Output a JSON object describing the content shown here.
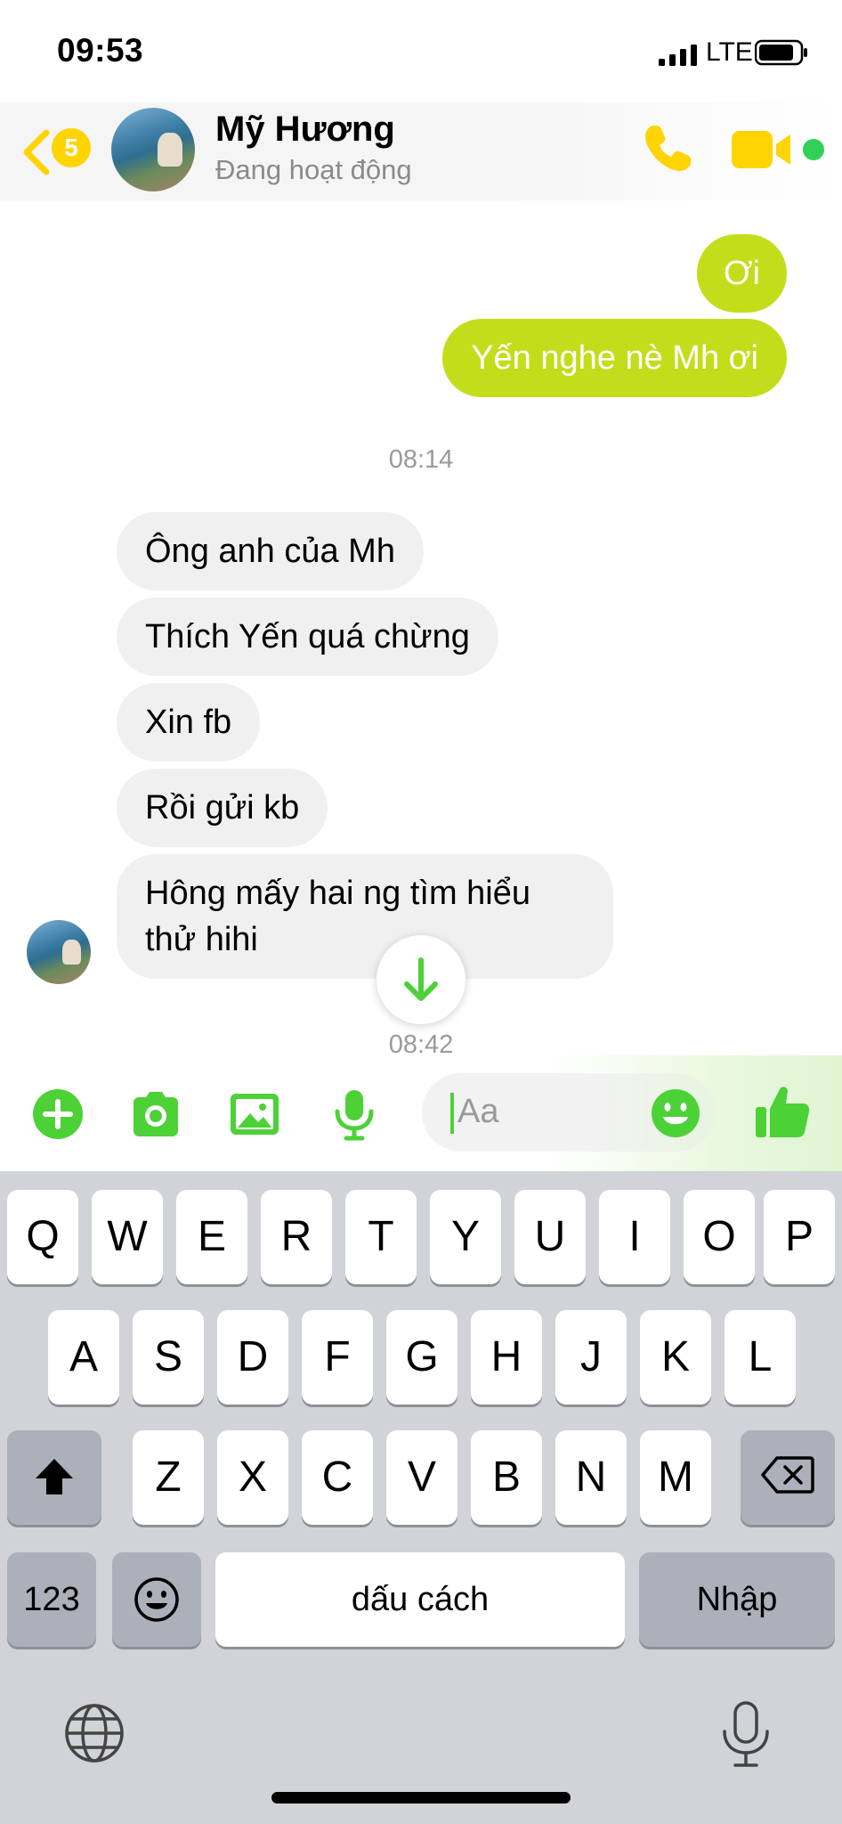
{
  "status_bar": {
    "time": "09:53",
    "network": "LTE"
  },
  "header": {
    "unread_count": "5",
    "contact_name": "Mỹ Hương",
    "contact_status": "Đang hoạt động"
  },
  "messages": [
    {
      "direction": "out",
      "text": "Ơi"
    },
    {
      "direction": "out",
      "text": "Yến nghe nè Mh ơi"
    },
    {
      "type": "timestamp",
      "text": "08:14"
    },
    {
      "direction": "in",
      "text": "Ông anh của Mh"
    },
    {
      "direction": "in",
      "text": "Thích Yến quá chừng"
    },
    {
      "direction": "in",
      "text": "Xin fb"
    },
    {
      "direction": "in",
      "text": "Rồi gửi kb"
    },
    {
      "direction": "in",
      "text_line1": "Hông mấy hai ng tìm hiểu",
      "text_line2": "thử hihi"
    },
    {
      "type": "timestamp",
      "text": "08:42"
    }
  ],
  "composer": {
    "placeholder": "Aa"
  },
  "keyboard": {
    "row1": [
      "Q",
      "W",
      "E",
      "R",
      "T",
      "Y",
      "U",
      "I",
      "O",
      "P"
    ],
    "row2": [
      "A",
      "S",
      "D",
      "F",
      "G",
      "H",
      "J",
      "K",
      "L"
    ],
    "row3": [
      "Z",
      "X",
      "C",
      "V",
      "B",
      "N",
      "M"
    ],
    "numbers_key": "123",
    "space_key": "dấu cách",
    "return_key": "Nhập"
  },
  "colors": {
    "outgoing_bubble": "#c3dd1b",
    "incoming_bubble": "#f0f0f0",
    "accent_yellow": "#ffd400",
    "accent_green": "#4cd137",
    "online": "#31d158"
  },
  "icons": [
    "back-chevron-icon",
    "phone-icon",
    "video-icon",
    "plus-icon",
    "camera-icon",
    "image-icon",
    "microphone-icon",
    "emoji-icon",
    "thumbs-up-icon",
    "arrow-down-icon",
    "shift-icon",
    "backspace-icon",
    "globe-icon",
    "dictation-icon"
  ]
}
